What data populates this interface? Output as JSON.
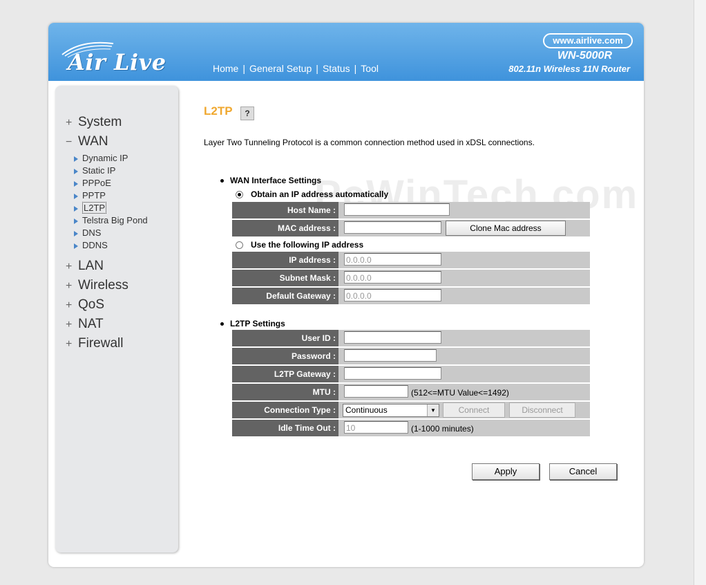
{
  "brand": {
    "logo_text": "Air Live",
    "url": "www.airlive.com",
    "model": "WN-5000R",
    "model_sub": "802.11n Wireless 11N Router"
  },
  "topnav": [
    "Home",
    "General Setup",
    "Status",
    "Tool"
  ],
  "sidebar": {
    "top_items": [
      {
        "sign": "+",
        "label": "System"
      },
      {
        "sign": "−",
        "label": "WAN"
      },
      {
        "sign": "+",
        "label": "LAN"
      },
      {
        "sign": "+",
        "label": "Wireless"
      },
      {
        "sign": "+",
        "label": "QoS"
      },
      {
        "sign": "+",
        "label": "NAT"
      },
      {
        "sign": "+",
        "label": "Firewall"
      }
    ],
    "wan_sub": [
      "Dynamic IP",
      "Static IP",
      "PPPoE",
      "PPTP",
      "L2TP",
      "Telstra Big Pond",
      "DNS",
      "DDNS"
    ],
    "active_sub": "L2TP"
  },
  "page": {
    "title": "L2TP",
    "help": "?",
    "description": "Layer Two Tunneling Protocol is a common connection method used in xDSL connections."
  },
  "wan_section": {
    "header": "WAN Interface Settings",
    "radio_auto": "Obtain an IP address automatically",
    "host_name_label": "Host Name :",
    "host_name_value": "",
    "mac_label": "MAC address :",
    "mac_value": "",
    "clone_mac_button": "Clone Mac address",
    "radio_static": "Use the following IP address",
    "ip_label": "IP address :",
    "ip_value": "0.0.0.0",
    "mask_label": "Subnet Mask :",
    "mask_value": "0.0.0.0",
    "gateway_label": "Default Gateway :",
    "gateway_value": "0.0.0.0"
  },
  "l2tp_section": {
    "header": "L2TP Settings",
    "user_label": "User ID :",
    "user_value": "",
    "password_label": "Password :",
    "password_value": "",
    "gateway_label": "L2TP Gateway :",
    "gateway_value": "",
    "mtu_label": "MTU :",
    "mtu_value": "",
    "mtu_note": "(512<=MTU Value<=1492)",
    "conn_type_label": "Connection Type :",
    "conn_type_value": "Continuous",
    "connect_button": "Connect",
    "disconnect_button": "Disconnect",
    "idle_label": "Idle Time Out :",
    "idle_value": "10",
    "idle_note": "(1-1000 minutes)"
  },
  "actions": {
    "apply": "Apply",
    "cancel": "Cancel"
  },
  "watermark": "PcWinTech.com"
}
